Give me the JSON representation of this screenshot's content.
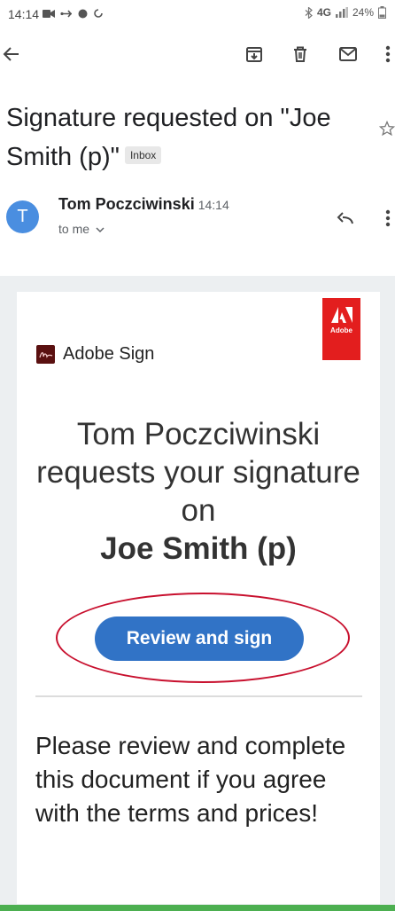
{
  "status_bar": {
    "time": "14:14",
    "network": "4G",
    "battery": "24%"
  },
  "toolbar": {
    "back_icon": "arrow-left-icon",
    "archive_icon": "archive-icon",
    "delete_icon": "trash-icon",
    "mark_unread_icon": "mail-icon",
    "more_icon": "more-vert-icon"
  },
  "email": {
    "subject": "Signature requested on \"Joe Smith (p)\"",
    "label": "Inbox",
    "sender": {
      "initial": "T",
      "name": "Tom Poczciwinski",
      "time": "14:14",
      "recipient": "to me"
    },
    "body": {
      "adobe_badge": "Adobe",
      "brand": "Adobe Sign",
      "headline": "Tom Poczciwinski requests your signature on",
      "document_name": "Joe Smith (p)",
      "cta_label": "Review and sign",
      "message": "Please review and complete this document if you agree with the terms and prices!"
    }
  },
  "colors": {
    "avatar": "#4a8ee0",
    "cta": "#3173c6",
    "adobe_red": "#e31e1e",
    "highlight_ellipse": "#c8102e"
  }
}
